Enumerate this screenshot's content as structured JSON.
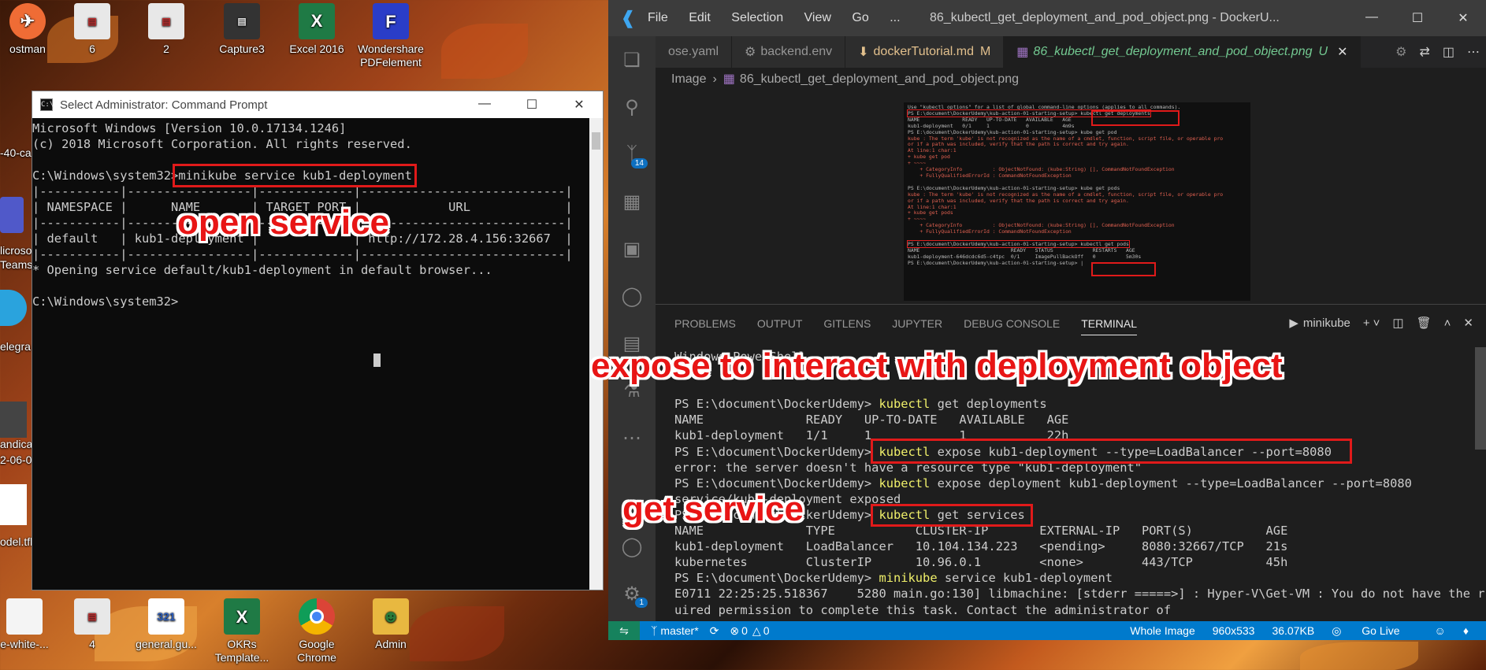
{
  "desktop": {
    "icons": [
      {
        "label": "ostman",
        "name": "postman-icon"
      },
      {
        "label": "6",
        "name": "image-file-icon"
      },
      {
        "label": "2",
        "name": "image-file-icon"
      },
      {
        "label": "Capture3",
        "name": "image-file-icon"
      },
      {
        "label": "Excel 2016",
        "name": "excel-icon"
      },
      {
        "label": "Wondershare PDFelement",
        "name": "pdfelement-icon"
      },
      {
        "label": "4",
        "name": "image-file-icon"
      },
      {
        "label": "general.gu...",
        "name": "calendar-file-icon"
      },
      {
        "label": "OKRs Template...",
        "name": "excel-file-icon"
      },
      {
        "label": "Google Chrome",
        "name": "chrome-icon"
      },
      {
        "label": "Admin",
        "name": "user-folder-icon"
      },
      {
        "label": "e-white-...",
        "name": "image-file-icon"
      }
    ],
    "edge_labels": [
      "-40-ca",
      "licroso",
      "Teams*",
      "elegra",
      "andica",
      "2-06-0",
      "odel.tfl"
    ]
  },
  "cmd": {
    "title": "Select Administrator: Command Prompt",
    "lines": [
      "Microsoft Windows [Version 10.0.17134.1246]",
      "(c) 2018 Microsoft Corporation. All rights reserved.",
      "",
      "C:\\Windows\\system32>minikube service kub1-deployment",
      "|-----------|-----------------|-------------|----------------------------|",
      "| NAMESPACE |      NAME       | TARGET PORT |            URL             |",
      "|-----------|-----------------|-------------|----------------------------|",
      "| default   | kub1-deployment |             | http://172.28.4.156:32667  |",
      "|-----------|-----------------|-------------|----------------------------|",
      "* Opening service default/kub1-deployment in default browser...",
      "",
      "C:\\Windows\\system32>"
    ]
  },
  "vscode": {
    "menu": [
      "File",
      "Edit",
      "Selection",
      "View",
      "Go",
      "..."
    ],
    "window_title": "86_kubectl_get_deployment_and_pod_object.png - DockerU...",
    "tabs": [
      {
        "label": "ose.yaml",
        "icon": "yaml-icon"
      },
      {
        "label": "backend.env",
        "icon": "gear-icon"
      },
      {
        "label": "dockerTutorial.md",
        "modified": "M",
        "icon": "markdown-icon"
      },
      {
        "label": "86_kubectl_get_deployment_and_pod_object.png",
        "modified": "U",
        "icon": "image-icon",
        "active": true
      }
    ],
    "breadcrumb": [
      "Image",
      "86_kubectl_get_deployment_and_pod_object.png"
    ],
    "activity_badges": {
      "source_control": "14",
      "settings": "1"
    },
    "preview_lines": [
      "Use \"kubectl options\" for a list of global command-line options (applies to all commands).",
      "PS E:\\document\\DockerUdemy\\kub-action-01-starting-setup> kubectl get deployments",
      "NAME              READY   UP-TO-DATE   AVAILABLE   AGE",
      "kub1-deployment   0/1     1            0           4m9s",
      "PS E:\\document\\DockerUdemy\\kub-action-01-starting-setup> kube get pod",
      "kube : The term 'kube' is not recognized as the name of a cmdlet, function, script file, or operable pro",
      "or if a path was included, verify that the path is correct and try again.",
      "At line:1 char:1",
      "+ kube get pod",
      "+ ~~~~",
      "    + CategoryInfo          : ObjectNotFound: (kube:String) [], CommandNotFoundException",
      "    + FullyQualifiedErrorId : CommandNotFoundException",
      "",
      "PS E:\\document\\DockerUdemy\\kub-action-01-starting-setup> kube get pods",
      "kube : The term 'kube' is not recognized as the name of a cmdlet, function, script file, or operable pro",
      "or if a path was included, verify that the path is correct and try again.",
      "At line:1 char:1",
      "+ kube get pods",
      "+ ~~~~",
      "    + CategoryInfo          : ObjectNotFound: (kube:String) [], CommandNotFoundException",
      "    + FullyQualifiedErrorId : CommandNotFoundException",
      "",
      "PS E:\\document\\DockerUdemy\\kub-action-01-starting-setup> kubectl get pods",
      "NAME                              READY   STATUS             RESTARTS   AGE",
      "kub1-deployment-646dcdc6d5-c4tpc  0/1     ImagePullBackOff   0          5m30s",
      "PS E:\\document\\DockerUdemy\\kub-action-01-starting-setup> |"
    ],
    "panel_tabs": [
      "PROBLEMS",
      "OUTPUT",
      "GITLENS",
      "JUPYTER",
      "DEBUG CONSOLE",
      "TERMINAL"
    ],
    "terminal_name": "minikube",
    "terminal_lines": [
      {
        "pre": "Windows PowerShell",
        "cmd": "",
        "post": ""
      },
      {
        "pre": "",
        "cmd": "",
        "post": ""
      },
      {
        "pre": "",
        "cmd": "",
        "post": ""
      },
      {
        "pre": "PS E:\\document\\DockerUdemy> ",
        "cmd": "kubectl",
        "post": " get deployments"
      },
      {
        "pre": "NAME              READY   UP-TO-DATE   AVAILABLE   AGE",
        "cmd": "",
        "post": ""
      },
      {
        "pre": "kub1-deployment   1/1     1            1           22h",
        "cmd": "",
        "post": ""
      },
      {
        "pre": "PS E:\\document\\DockerUdemy> ",
        "cmd": "kubectl",
        "post": " expose kub1-deployment --type=LoadBalancer --port=8080"
      },
      {
        "pre": "error: the server doesn't have a resource type \"kub1-deployment\"",
        "cmd": "",
        "post": ""
      },
      {
        "pre": "PS E:\\document\\DockerUdemy> ",
        "cmd": "kubectl",
        "post": " expose deployment kub1-deployment --type=LoadBalancer --port=8080"
      },
      {
        "pre": "service/kub1-deployment exposed",
        "cmd": "",
        "post": ""
      },
      {
        "pre": "PS E:\\document\\DockerUdemy> ",
        "cmd": "kubectl",
        "post": " get services"
      },
      {
        "pre": "NAME              TYPE           CLUSTER-IP       EXTERNAL-IP   PORT(S)          AGE",
        "cmd": "",
        "post": ""
      },
      {
        "pre": "kub1-deployment   LoadBalancer   10.104.134.223   <pending>     8080:32667/TCP   21s",
        "cmd": "",
        "post": ""
      },
      {
        "pre": "kubernetes        ClusterIP      10.96.0.1        <none>        443/TCP          45h",
        "cmd": "",
        "post": ""
      },
      {
        "pre": "PS E:\\document\\DockerUdemy> ",
        "cmd": "minikube",
        "post": " service kub1-deployment"
      },
      {
        "pre": "E0711 22:25:25.518367    5280 main.go:130] libmachine: [stderr =====>] : Hyper-V\\Get-VM : You do not have the r",
        "cmd": "",
        "post": ""
      },
      {
        "pre": "uired permission to complete this task. Contact the administrator of",
        "cmd": "",
        "post": ""
      }
    ],
    "status": {
      "branch": "master*",
      "errors": "0",
      "warnings": "0",
      "right": [
        "Whole Image",
        "960x533",
        "36.07KB",
        "Go Live"
      ]
    }
  },
  "annotations": {
    "open_service": "open service",
    "expose": "expose to interact with deployment object",
    "get_service": "get service"
  }
}
